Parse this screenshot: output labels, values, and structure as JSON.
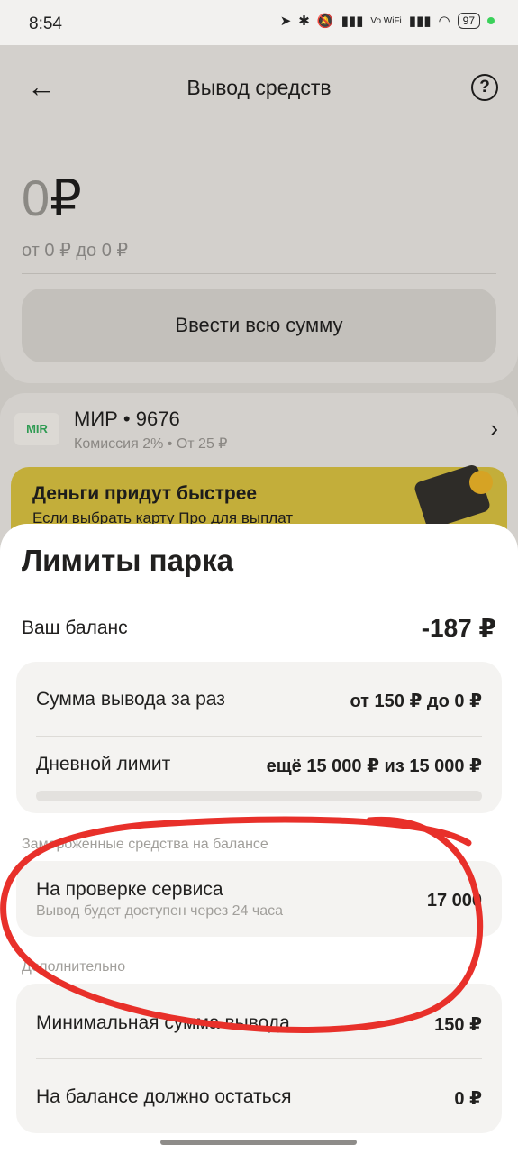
{
  "status_bar": {
    "time": "8:54",
    "battery": "97",
    "network": "Vo WiFi"
  },
  "header": {
    "back_icon": "arrow-left-icon",
    "title": "Вывод средств",
    "help_icon": "question-circle-icon"
  },
  "amount": {
    "value": "0",
    "currency": "₽",
    "range": "от 0 ₽ до 0 ₽",
    "enter_all_label": "Ввести всю сумму"
  },
  "card": {
    "logo": "MIR",
    "name": "МИР • 9676",
    "fee": "Комиссия 2% • От 25 ₽"
  },
  "promo": {
    "title": "Деньги придут быстрее",
    "subtitle": "Если выбрать карту Про для выплат"
  },
  "sheet": {
    "title": "Лимиты парка",
    "balance_label": "Ваш баланс",
    "balance_value": "-187 ₽",
    "limits": {
      "per_withdrawal_label": "Сумма вывода за раз",
      "per_withdrawal_value": "от 150 ₽ до 0 ₽",
      "daily_label": "Дневной лимит",
      "daily_value": "ещё 15 000 ₽ из 15 000 ₽",
      "daily_used_fraction": 0
    },
    "frozen": {
      "section_label": "Замороженные средства на балансе",
      "label": "На проверке сервиса",
      "sublabel": "Вывод будет доступен через 24 часа",
      "value": "17 000"
    },
    "extra": {
      "section_label": "Дополнительно",
      "min_label": "Минимальная сумма вывода",
      "min_value": "150 ₽",
      "remain_label": "На балансе должно остаться",
      "remain_value": "0 ₽"
    }
  },
  "colors": {
    "annotation": "#e8302a",
    "promo": "#f5d64a",
    "accent_green": "#2f9b52"
  }
}
